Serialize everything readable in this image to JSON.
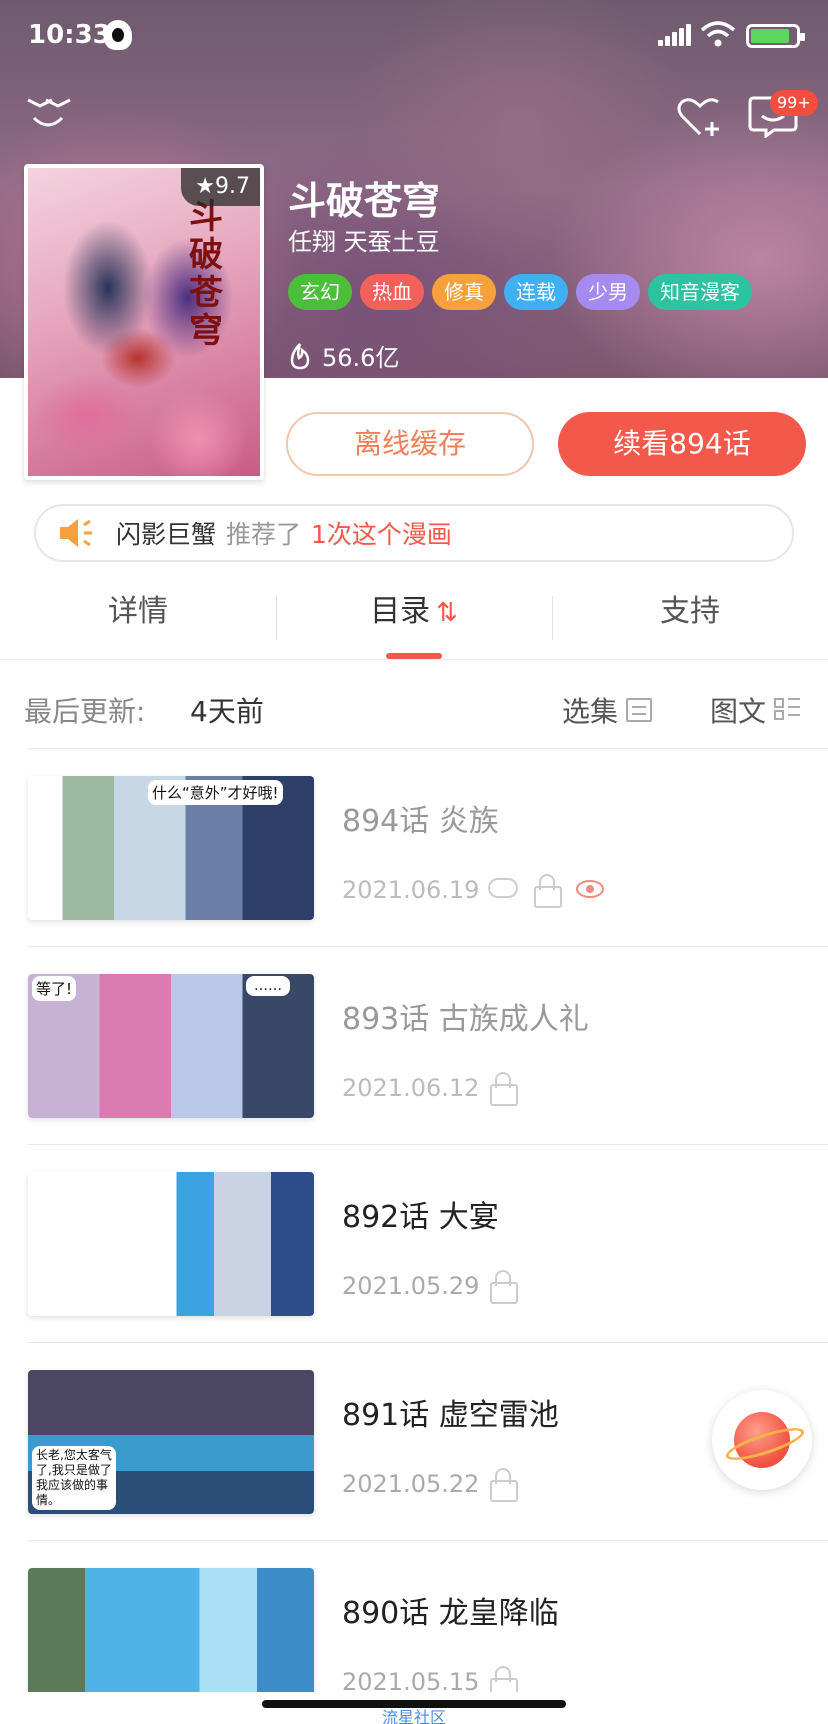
{
  "status_bar": {
    "time": "10:33"
  },
  "header": {
    "title": "斗破苍穹",
    "authors": "任翔 天蚕土豆",
    "tags": [
      {
        "label": "玄幻",
        "color": "#4cbf3a"
      },
      {
        "label": "热血",
        "color": "#f2605a"
      },
      {
        "label": "修真",
        "color": "#f6a13b"
      },
      {
        "label": "连载",
        "color": "#3fb0f2"
      },
      {
        "label": "少男",
        "color": "#a58af0"
      },
      {
        "label": "知音漫客",
        "color": "#2cc3a0"
      }
    ],
    "popularity": "56.6亿",
    "score": "9.7",
    "cover_title": "斗破苍穹",
    "msg_badge": "99+"
  },
  "actions": {
    "offline_label": "离线缓存",
    "continue_label": "续看894话"
  },
  "recommend": {
    "user": "闪影巨蟹",
    "middle": "推荐了",
    "count": "1次这个漫画"
  },
  "tabs": [
    {
      "label": "详情"
    },
    {
      "label": "目录"
    },
    {
      "label": "支持"
    }
  ],
  "list_header": {
    "label": "最后更新:",
    "value": "4天前",
    "select_label": "选集",
    "view_label": "图文"
  },
  "chapters": [
    {
      "title": "894话   炎族",
      "date": "2021.06.19",
      "read": true
    },
    {
      "title": "893话   古族成人礼",
      "date": "2021.06.12",
      "read": true
    },
    {
      "title": "892话   大宴",
      "date": "2021.05.29",
      "read": false
    },
    {
      "title": "891话   虚空雷池",
      "date": "2021.05.22",
      "read": false
    },
    {
      "title": "890话   龙皇降临",
      "date": "2021.05.15",
      "read": false
    }
  ],
  "thumb_texts": {
    "t1": "什么“意外”才好哦!",
    "t2a": "等了!",
    "t2b": "……",
    "t4": "长老,您太客气了,我只是做了我应该做的事情。"
  },
  "footer": {
    "watermark": "流星社区"
  }
}
